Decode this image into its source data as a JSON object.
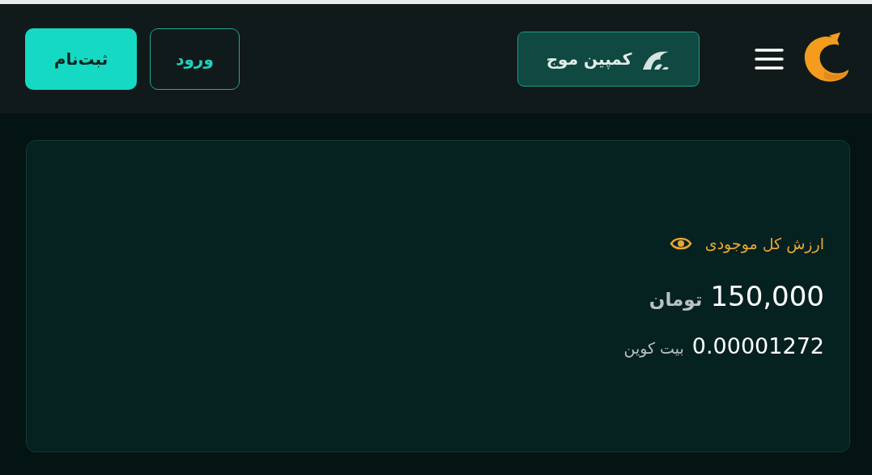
{
  "header": {
    "campaign_button": "کمپین موج",
    "login_button": "ورود",
    "signup_button": "ثبت‌نام"
  },
  "balance_card": {
    "label": "ارزش کل موجودی",
    "amount": "150,000",
    "amount_unit": "تومان",
    "crypto_amount": "0.00001272",
    "crypto_unit": "بیت کوین"
  }
}
